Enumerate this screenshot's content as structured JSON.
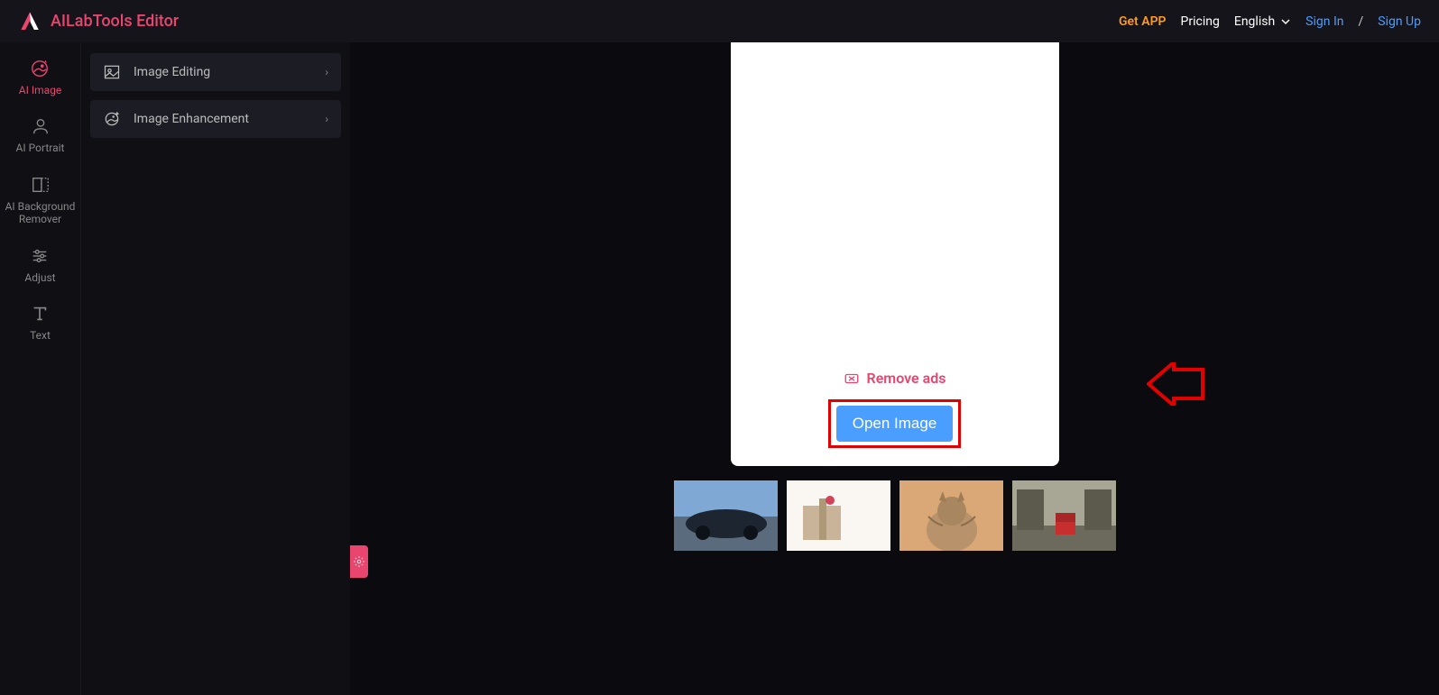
{
  "header": {
    "title": "AILabTools Editor",
    "get_app": "Get APP",
    "pricing": "Pricing",
    "language": "English",
    "sign_in": "Sign In",
    "sign_up": "Sign Up"
  },
  "sidebar": {
    "items": [
      {
        "label": "AI Image",
        "icon": "ai-image-icon",
        "active": true
      },
      {
        "label": "AI Portrait",
        "icon": "ai-portrait-icon",
        "active": false
      },
      {
        "label": "AI Background Remover",
        "icon": "bg-remover-icon",
        "active": false
      },
      {
        "label": "Adjust",
        "icon": "adjust-icon",
        "active": false
      },
      {
        "label": "Text",
        "icon": "text-icon",
        "active": false
      }
    ]
  },
  "panel": {
    "items": [
      {
        "label": "Image Editing",
        "icon": "image-editing-icon"
      },
      {
        "label": "Image Enhancement",
        "icon": "image-enhancement-icon"
      }
    ]
  },
  "canvas": {
    "remove_ads": "Remove ads",
    "open_image": "Open Image"
  },
  "thumbnails": [
    {
      "name": "car"
    },
    {
      "name": "giftbox"
    },
    {
      "name": "cat"
    },
    {
      "name": "street-chair"
    }
  ]
}
